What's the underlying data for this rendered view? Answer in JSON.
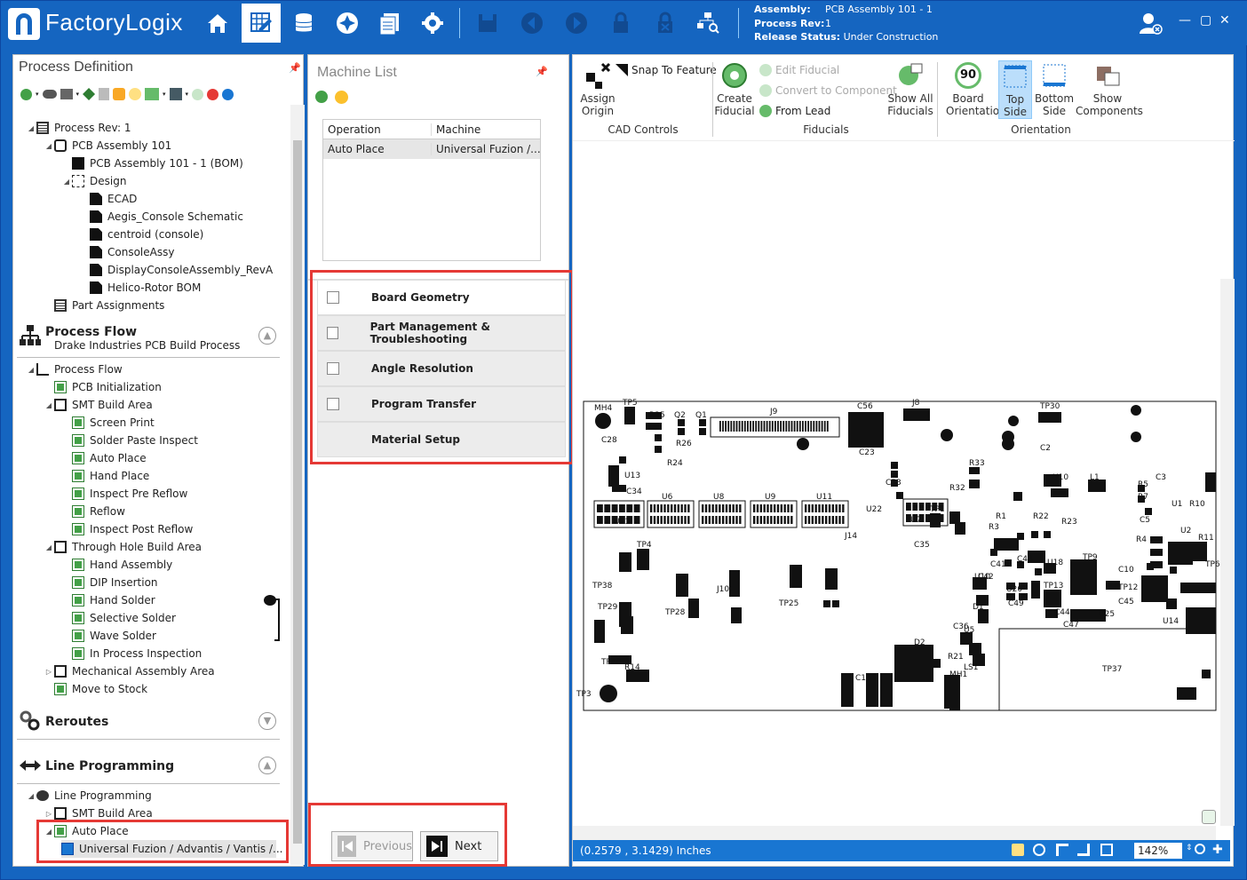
{
  "app": {
    "brand": "FactoryLogix"
  },
  "assembly_info": {
    "assembly_label": "Assembly:",
    "assembly_value": "PCB Assembly 101 - 1",
    "rev_label": "Process Rev:",
    "rev_value": "1",
    "status_label": "Release Status:",
    "status_value": "Under Construction"
  },
  "window": {
    "min": "—",
    "max": "▢",
    "close": "✕"
  },
  "process_definition": {
    "title": "Process Definition",
    "tree": [
      {
        "label": "Process Rev: 1",
        "icon": "list-icon"
      },
      {
        "label": "PCB Assembly 101",
        "icon": "cube-icon"
      },
      {
        "label": "PCB Assembly 101 - 1 (BOM)",
        "icon": "bom-icon"
      },
      {
        "label": "Design",
        "icon": "design-icon"
      },
      {
        "label": "ECAD",
        "icon": "document-icon"
      },
      {
        "label": "Aegis_Console Schematic",
        "icon": "document-icon"
      },
      {
        "label": "centroid (console)",
        "icon": "document-icon"
      },
      {
        "label": "ConsoleAssy",
        "icon": "document-icon"
      },
      {
        "label": "DisplayConsoleAssembly_RevA",
        "icon": "document-icon"
      },
      {
        "label": "Helico-Rotor BOM",
        "icon": "document-icon"
      },
      {
        "label": "Part Assignments",
        "icon": "list-icon"
      }
    ]
  },
  "process_flow": {
    "title": "Process Flow",
    "subtitle": "Drake Industries PCB Build Process",
    "tree": [
      {
        "label": "Process Flow"
      },
      {
        "label": "PCB Initialization"
      },
      {
        "label": "SMT Build Area"
      },
      {
        "label": "Screen Print"
      },
      {
        "label": "Solder Paste Inspect"
      },
      {
        "label": "Auto Place"
      },
      {
        "label": "Hand Place"
      },
      {
        "label": "Inspect Pre Reflow"
      },
      {
        "label": "Reflow"
      },
      {
        "label": "Inspect Post Reflow"
      },
      {
        "label": "Through Hole Build Area"
      },
      {
        "label": "Hand Assembly"
      },
      {
        "label": "DIP Insertion"
      },
      {
        "label": "Hand Solder"
      },
      {
        "label": "Selective Solder"
      },
      {
        "label": "Wave Solder"
      },
      {
        "label": "In Process Inspection"
      },
      {
        "label": "Mechanical Assembly Area"
      },
      {
        "label": "Move to Stock"
      }
    ]
  },
  "reroutes": {
    "title": "Reroutes"
  },
  "line_programming": {
    "title": "Line Programming",
    "tree": [
      {
        "label": "Line Programming"
      },
      {
        "label": "SMT Build Area"
      },
      {
        "label": "Auto Place"
      },
      {
        "label": "Universal Fuzion / Advantis / Vantis /..."
      }
    ]
  },
  "machine_list": {
    "title": "Machine List",
    "headers": [
      "Operation",
      "Machine"
    ],
    "rows": [
      [
        "Auto Place",
        "Universal Fuzion /..."
      ]
    ],
    "steps": [
      {
        "label": "Board Geometry"
      },
      {
        "label": "Part Management & Troubleshooting"
      },
      {
        "label": "Angle Resolution"
      },
      {
        "label": "Program Transfer"
      },
      {
        "label": "Material Setup"
      }
    ],
    "previous": "Previous",
    "next": "Next"
  },
  "ribbon": {
    "assign_origin": "Assign Origin",
    "snap_to_feature": "Snap To Feature",
    "cad_controls": "CAD Controls",
    "create_fiducial": "Create Fiducial",
    "edit_fiducial": "Edit Fiducial",
    "convert_to_component": "Convert to Component",
    "from_lead": "From Lead",
    "show_all_fiducials": "Show All Fiducials",
    "fiducials": "Fiducials",
    "board_orientation": "Board Orientation",
    "top_side": "Top Side",
    "bottom_side": "Bottom Side",
    "show_components": "Show Components",
    "orientation": "Orientation",
    "board_angle": "90"
  },
  "pcb": {
    "labels": [
      "MH4",
      "TP5",
      "R25",
      "Q2",
      "Q1",
      "J9",
      "C56",
      "J8",
      "TP30",
      "C28",
      "R26",
      "C23",
      "C2",
      "R24",
      "R33",
      "U13",
      "C34",
      "C53",
      "R32",
      "U10",
      "L1",
      "C3",
      "U6",
      "U8",
      "U9",
      "U11",
      "U22",
      "U7",
      "TP1",
      "R1",
      "R22",
      "R23",
      "R5",
      "R7",
      "U1",
      "R10",
      "C5",
      "U21",
      "TP4",
      "J14",
      "C35",
      "R3",
      "R4",
      "U2",
      "R11",
      "TP38",
      "J10",
      "TP25",
      "C42",
      "C48",
      "U18",
      "TP9",
      "C10",
      "TP6",
      "TP29",
      "TP28",
      "U10",
      "U20",
      "TP13",
      "TP12",
      "C45",
      "C49",
      "C44",
      "C47",
      "U25",
      "D1",
      "D2",
      "C36",
      "U5",
      "U14",
      "R21",
      "LS1",
      "TP37",
      "TP40",
      "R14",
      "MH1",
      "TP3",
      "C15",
      "C41"
    ]
  },
  "status": {
    "coords": "(0.2579 , 3.1429) Inches",
    "zoom": "142%"
  }
}
